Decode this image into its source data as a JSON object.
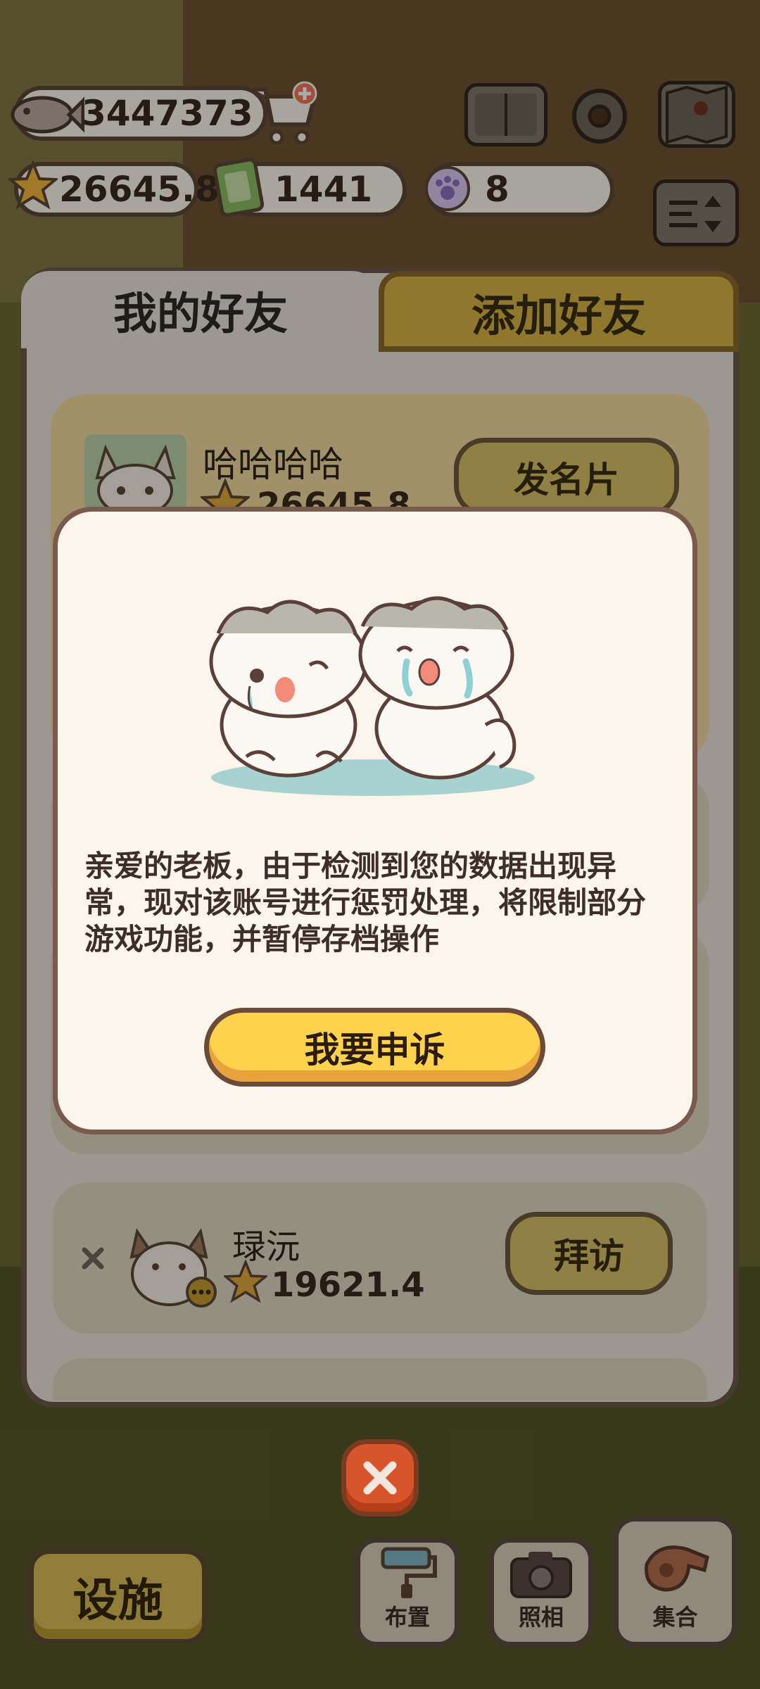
{
  "hud": {
    "fish_count": "3447373",
    "stars": "26645.8",
    "tickets": "1441",
    "paw_coins": "8"
  },
  "tabs": {
    "my_friends": "我的好友",
    "add_friend": "添加好友"
  },
  "friends": [
    {
      "name": "哈哈哈哈",
      "stars": "26645.8",
      "action": "发名片"
    },
    {
      "name": "琭沅",
      "stars": "19621.4",
      "action": "拜访"
    }
  ],
  "dialog": {
    "message": "亲爱的老板，由于检测到您的数据出现异常，现对该账号进行惩罚处理，将限制部分游戏功能，并暂停存档操作",
    "appeal_label": "我要申诉"
  },
  "bottom_bar": {
    "facility": "设施",
    "arrange": "布置",
    "photo": "照相",
    "gather": "集合"
  },
  "colors": {
    "accent_yellow": "#ffd24e",
    "close_red": "#d8552b",
    "panel_border": "#6b574a"
  }
}
